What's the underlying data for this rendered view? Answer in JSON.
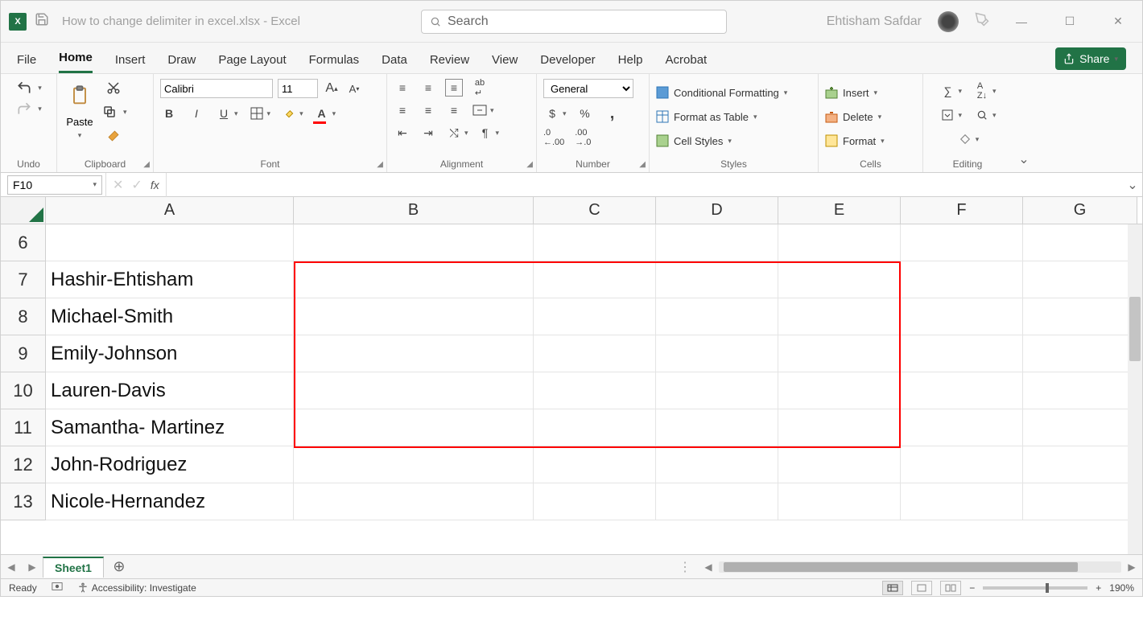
{
  "title": {
    "filename": "How to change delimiter in excel.xlsx",
    "sep": "  -  ",
    "app": "Excel"
  },
  "search_placeholder": "Search",
  "user_name": "Ehtisham Safdar",
  "tabs": {
    "file": "File",
    "home": "Home",
    "insert": "Insert",
    "draw": "Draw",
    "pagelayout": "Page Layout",
    "formulas": "Formulas",
    "data": "Data",
    "review": "Review",
    "view": "View",
    "developer": "Developer",
    "help": "Help",
    "acrobat": "Acrobat"
  },
  "share_label": "Share",
  "ribbon": {
    "undo_label": "Undo",
    "clipboard_label": "Clipboard",
    "paste_label": "Paste",
    "font_label": "Font",
    "font_name": "Calibri",
    "font_size": "11",
    "alignment_label": "Alignment",
    "number_label": "Number",
    "number_format": "General",
    "styles_label": "Styles",
    "cond_fmt": "Conditional Formatting",
    "fmt_table": "Format as Table",
    "cell_styles": "Cell Styles",
    "cells_label": "Cells",
    "insert": "Insert",
    "delete": "Delete",
    "format": "Format",
    "editing_label": "Editing"
  },
  "namebox": "F10",
  "columns": [
    "A",
    "B",
    "C",
    "D",
    "E",
    "F",
    "G"
  ],
  "rows": [
    {
      "n": "6",
      "a": ""
    },
    {
      "n": "7",
      "a": "Hashir-Ehtisham"
    },
    {
      "n": "8",
      "a": "Michael-Smith"
    },
    {
      "n": "9",
      "a": "Emily-Johnson"
    },
    {
      "n": "10",
      "a": "Lauren-Davis"
    },
    {
      "n": "11",
      "a": "Samantha- Martinez"
    },
    {
      "n": "12",
      "a": "John-Rodriguez"
    },
    {
      "n": "13",
      "a": "Nicole-Hernandez"
    }
  ],
  "sheet_tab": "Sheet1",
  "status": {
    "ready": "Ready",
    "accessibility": "Accessibility: Investigate",
    "zoom": "190%"
  }
}
